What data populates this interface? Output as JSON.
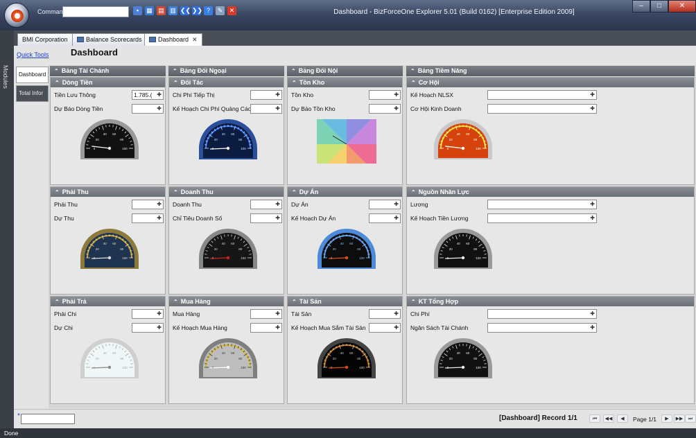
{
  "window": {
    "title": "Dashboard - BizForceOne Explorer 5.01 (Build 0162) [Enterprise Edition 2009]",
    "command_label": "Command"
  },
  "quick_access": [
    {
      "icon": "save-icon",
      "color": "#4f7fd6"
    },
    {
      "icon": "grid-icon",
      "color": "#3e7ad0"
    },
    {
      "icon": "chart-icon",
      "color": "#d04a3a"
    },
    {
      "icon": "table-icon",
      "color": "#3f82d8"
    },
    {
      "icon": "back-icon",
      "color": "#2f6de0"
    },
    {
      "icon": "forward-icon",
      "color": "#2f6de0"
    },
    {
      "icon": "help-icon",
      "color": "#3a7de3"
    },
    {
      "icon": "pen-icon",
      "color": "#8aa0bf"
    },
    {
      "icon": "close-icon",
      "color": "#d63a2a"
    }
  ],
  "side": {
    "modules_label": "Modules"
  },
  "tabs": [
    {
      "label": "BMI Corporation"
    },
    {
      "label": "Balance Scorecards"
    },
    {
      "label": "Dashboard"
    }
  ],
  "left_nav": {
    "quick_tools": "Quick Tools",
    "tabs": [
      {
        "label": "Dashboard"
      },
      {
        "label": "Total Infor"
      }
    ]
  },
  "page_title": "Dashboard",
  "columns": [
    {
      "title": "Bảng Tài Chánh"
    },
    {
      "title": "Bảng Đối Ngoại"
    },
    {
      "title": "Bảng Đối Nội"
    },
    {
      "title": "Bảng Tiềm Năng"
    }
  ],
  "panels": [
    {
      "title": "Dòng Tiền",
      "fields": [
        {
          "label": "Tiền Lưu Thông",
          "value": "1.785.("
        },
        {
          "label": "Dự Báo Dòng Tiền",
          "value": ""
        }
      ],
      "gauge": {
        "style": "dark",
        "value": 0.05
      }
    },
    {
      "title": "Đối Tác",
      "fields": [
        {
          "label": "Chi Phí Tiếp Thị",
          "value": ""
        },
        {
          "label": "Kế Hoạch Chi Phí Quảng Cáo",
          "value": ""
        }
      ],
      "gauge": {
        "style": "blue",
        "value": 0.0
      }
    },
    {
      "title": "Tồn Kho",
      "fields": [
        {
          "label": "Tồn Kho",
          "value": ""
        },
        {
          "label": "Dự Báo Tồn Kho",
          "value": ""
        }
      ],
      "gauge": {
        "style": "rainbow",
        "value": 0.2
      }
    },
    {
      "title": "Cơ Hội",
      "fields": [
        {
          "label": "Kế Hoạch NLSX",
          "value": ""
        },
        {
          "label": "Cơ Hội Kinh Doanh",
          "value": ""
        }
      ],
      "gauge": {
        "style": "orange",
        "value": 0.05
      }
    },
    {
      "title": "Phải Thu",
      "fields": [
        {
          "label": "Phải Thu",
          "value": ""
        },
        {
          "label": "Dự Thu",
          "value": ""
        }
      ],
      "gauge": {
        "style": "navy",
        "value": 0.0
      }
    },
    {
      "title": "Doanh Thu",
      "fields": [
        {
          "label": "Doanh Thu",
          "value": ""
        },
        {
          "label": "Chỉ Tiêu Doanh Số",
          "value": ""
        }
      ],
      "gauge": {
        "style": "darkred",
        "value": 0.0
      }
    },
    {
      "title": "Dự Án",
      "fields": [
        {
          "label": "Dự Án",
          "value": ""
        },
        {
          "label": "Kế Hoạch Dự Án",
          "value": ""
        }
      ],
      "gauge": {
        "style": "bluerim",
        "value": 0.0
      }
    },
    {
      "title": "Nguồn Nhân Lực",
      "fields": [
        {
          "label": "Lương",
          "value": ""
        },
        {
          "label": "Kế Hoạch Tiền Lương",
          "value": ""
        }
      ],
      "gauge": {
        "style": "dark",
        "value": 0.0
      }
    },
    {
      "title": "Phải Trả",
      "fields": [
        {
          "label": "Phải Chi",
          "value": ""
        },
        {
          "label": "Dự Chi",
          "value": ""
        }
      ],
      "gauge": {
        "style": "white",
        "value": 0.0
      }
    },
    {
      "title": "Mua Hàng",
      "fields": [
        {
          "label": "Mua Hàng",
          "value": ""
        },
        {
          "label": "Kế Hoạch Mua Hàng",
          "value": ""
        }
      ],
      "gauge": {
        "style": "silver",
        "value": 0.0
      }
    },
    {
      "title": "Tài Sản",
      "fields": [
        {
          "label": "Tài Sản",
          "value": ""
        },
        {
          "label": "Kế Hoạch Mua Sắm Tài Sản",
          "value": ""
        }
      ],
      "gauge": {
        "style": "black",
        "value": 0.0
      }
    },
    {
      "title": "KT Tổng Hợp",
      "fields": [
        {
          "label": "Chi Phí",
          "value": ""
        },
        {
          "label": "Ngân Sách Tài Chánh",
          "value": ""
        }
      ],
      "gauge": {
        "style": "dark",
        "value": 0.0
      }
    }
  ],
  "gauge_labels": [
    "0",
    "20",
    "40",
    "60",
    "80",
    "100"
  ],
  "bottom": {
    "star": "*",
    "record": "[Dashboard] Record 1/1",
    "page": "Page 1/1"
  },
  "status": "Done"
}
